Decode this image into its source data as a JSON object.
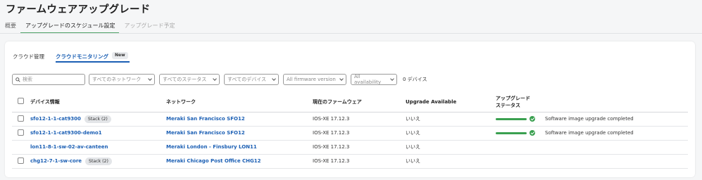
{
  "page": {
    "title": "ファームウェアアップグレード"
  },
  "top_tabs": [
    {
      "label": "概要"
    },
    {
      "label": "アップグレードのスケジュール設定"
    },
    {
      "label": "アップグレード予定"
    }
  ],
  "inner_tabs": {
    "cloud_management": "クラウド管理",
    "cloud_monitoring": "クラウドモニタリング",
    "new_badge": "New"
  },
  "filters": {
    "search_placeholder": "検索",
    "network": "すべてのネットワーク",
    "status": "すべてのステータス",
    "device": "すべてのデバイス",
    "firmware": "All firmware version",
    "availability": "All availability",
    "count": "0 デバイス"
  },
  "table": {
    "headers": {
      "device": "デバイス情報",
      "network": "ネットワーク",
      "firmware": "現在のファームウェア",
      "upgrade_available": "Upgrade Available",
      "status_line1": "アップグレード",
      "status_line2": "ステータス"
    },
    "rows": [
      {
        "device": "sfo12-1-1-cat9300",
        "stack": "Stack (2)",
        "network": "Meraki San Francisco SFO12",
        "firmware": "IOS-XE 17.12.3",
        "upgrade": "いいえ",
        "progress": 100,
        "status_text": "Software image upgrade completed"
      },
      {
        "device": "sfo12-1-1-cat9300-demo1",
        "stack": "",
        "network": "Meraki San Francisco SFO12",
        "firmware": "IOS-XE 17.12.3",
        "upgrade": "いいえ",
        "progress": 100,
        "status_text": "Software image upgrade completed"
      },
      {
        "device": "lon11-8-1-sw-02-av-canteen",
        "stack": "",
        "network": "Meraki London - Finsbury LON11",
        "firmware": "IOS-XE 17.12.3",
        "upgrade": "いいえ",
        "progress": null,
        "status_text": ""
      },
      {
        "device": "chg12-7-1-sw-core",
        "stack": "Stack (2)",
        "network": "Meraki Chicago Post Office CHG12",
        "firmware": "IOS-XE 17.12.3",
        "upgrade": "いいえ",
        "progress": null,
        "status_text": ""
      }
    ]
  },
  "colors": {
    "accent": "#1b5fb4",
    "success": "#3aa050",
    "tab_underline": "#51a36a"
  },
  "icons": [
    "search-icon",
    "chevron-down-icon",
    "check-circle-icon"
  ]
}
